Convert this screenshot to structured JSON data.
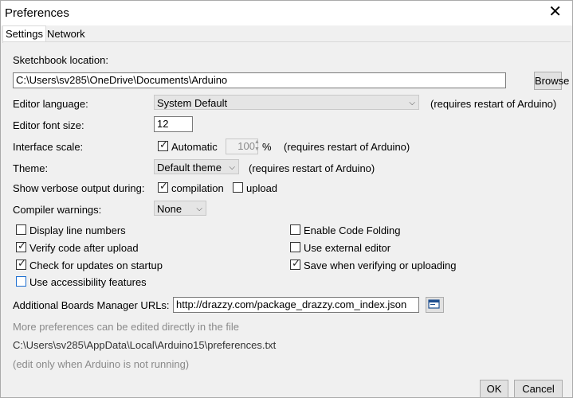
{
  "window": {
    "title": "Preferences"
  },
  "tabs": [
    "Settings",
    "Network"
  ],
  "sketchbook": {
    "label": "Sketchbook location:",
    "path": "C:\\Users\\sv285\\OneDrive\\Documents\\Arduino",
    "browse": "Browse"
  },
  "editor_language": {
    "label": "Editor language:",
    "value": "System Default",
    "note": "(requires restart of Arduino)"
  },
  "font_size": {
    "label": "Editor font size:",
    "value": "12"
  },
  "interface_scale": {
    "label": "Interface scale:",
    "automatic": "Automatic",
    "automatic_checked": true,
    "value": "100",
    "unit": "%",
    "note": "(requires restart of Arduino)"
  },
  "theme": {
    "label": "Theme:",
    "value": "Default theme",
    "note": "(requires restart of Arduino)"
  },
  "verbose": {
    "label": "Show verbose output during:",
    "compilation": "compilation",
    "compilation_checked": true,
    "upload": "upload",
    "upload_checked": false
  },
  "compiler_warnings": {
    "label": "Compiler warnings:",
    "value": "None"
  },
  "options_left": [
    {
      "label": "Display line numbers",
      "checked": false
    },
    {
      "label": "Verify code after upload",
      "checked": true
    },
    {
      "label": "Check for updates on startup",
      "checked": true
    },
    {
      "label": "Use accessibility features",
      "checked": false
    }
  ],
  "options_right": [
    {
      "label": "Enable Code Folding",
      "checked": false
    },
    {
      "label": "Use external editor",
      "checked": false
    },
    {
      "label": "Save when verifying or uploading",
      "checked": true
    }
  ],
  "boards_urls": {
    "label": "Additional Boards Manager URLs:",
    "value": "http://drazzy.com/package_drazzy.com_index.json"
  },
  "footer": {
    "more_prefs": "More preferences can be edited directly in the file",
    "prefs_path": "C:\\Users\\sv285\\AppData\\Local\\Arduino15\\preferences.txt",
    "edit_note": "(edit only when Arduino is not running)"
  },
  "buttons": {
    "ok": "OK",
    "cancel": "Cancel"
  }
}
